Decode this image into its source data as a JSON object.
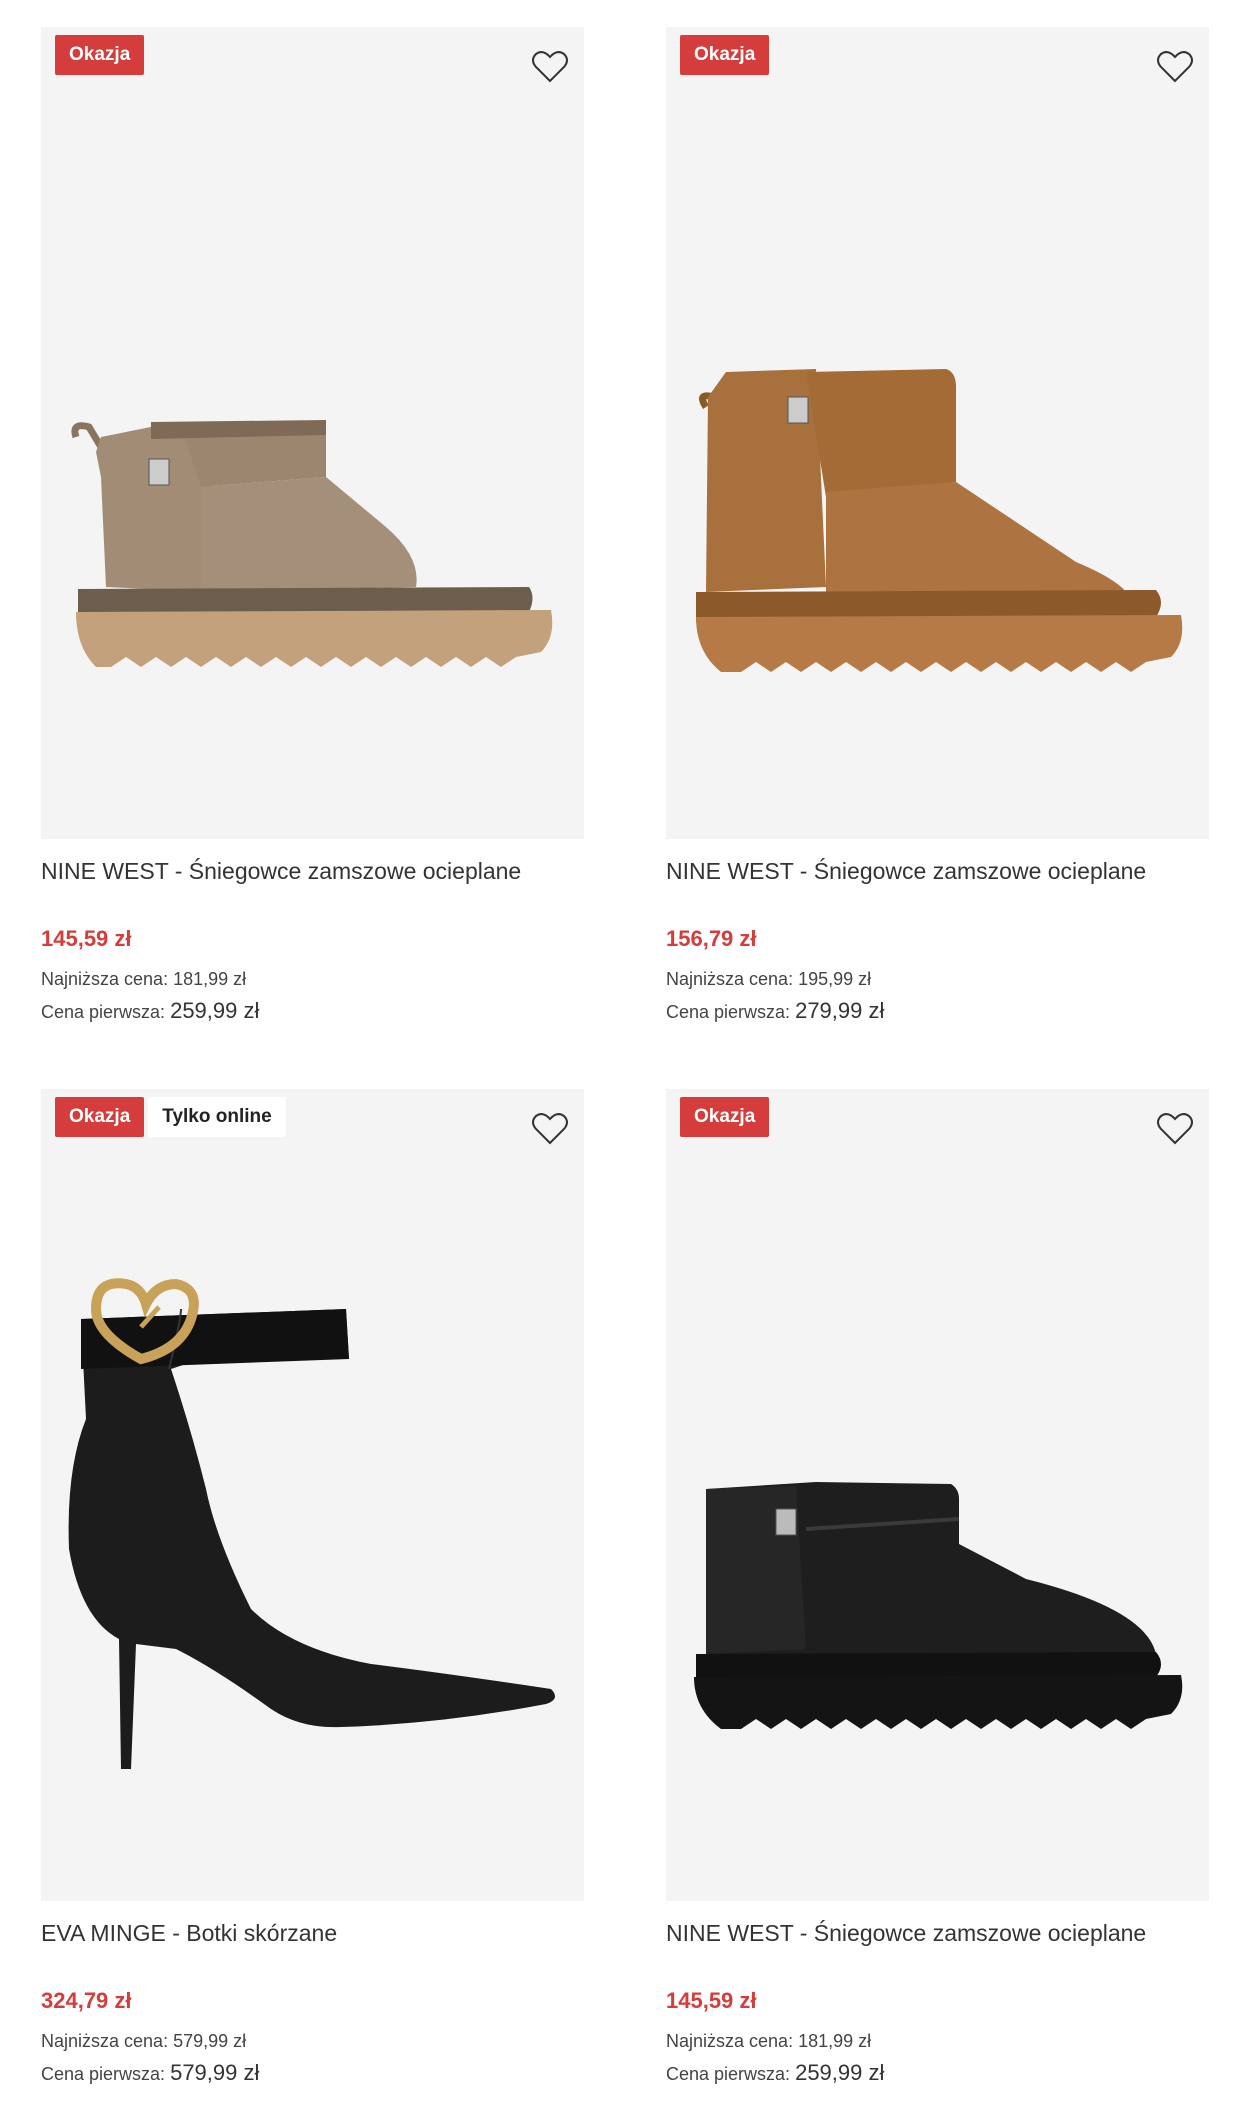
{
  "products": [
    {
      "badges": [
        "Okazja"
      ],
      "title": "NINE WEST - Śniegowce zamszowe ocieplane",
      "price": "145,59 zł",
      "lowest_label": "Najniższa cena:",
      "lowest_value": "181,99 zł",
      "original_label": "Cena pierwsza:",
      "original_value": "259,99 zł",
      "color": "#9c8670",
      "icon": "heart-icon"
    },
    {
      "badges": [
        "Okazja"
      ],
      "title": "NINE WEST - Śniegowce zamszowe ocieplane",
      "price": "156,79 zł",
      "lowest_label": "Najniższa cena:",
      "lowest_value": "195,99 zł",
      "original_label": "Cena pierwsza:",
      "original_value": "279,99 zł",
      "color": "#a8703d",
      "icon": "heart-icon"
    },
    {
      "badges": [
        "Okazja",
        "Tylko online"
      ],
      "title": "EVA MINGE - Botki skórzane",
      "price": "324,79 zł",
      "lowest_label": "Najniższa cena:",
      "lowest_value": "579,99 zł",
      "original_label": "Cena pierwsza:",
      "original_value": "579,99 zł",
      "color": "#1a1a1a",
      "icon": "heart-icon"
    },
    {
      "badges": [
        "Okazja"
      ],
      "title": "NINE WEST - Śniegowce zamszowe ocieplane",
      "price": "145,59 zł",
      "lowest_label": "Najniższa cena:",
      "lowest_value": "181,99 zł",
      "original_label": "Cena pierwsza:",
      "original_value": "259,99 zł",
      "color": "#1e1e1e",
      "icon": "heart-icon"
    }
  ],
  "colors": {
    "sale": "#d43d3b",
    "image_bg": "#f4f4f4"
  }
}
